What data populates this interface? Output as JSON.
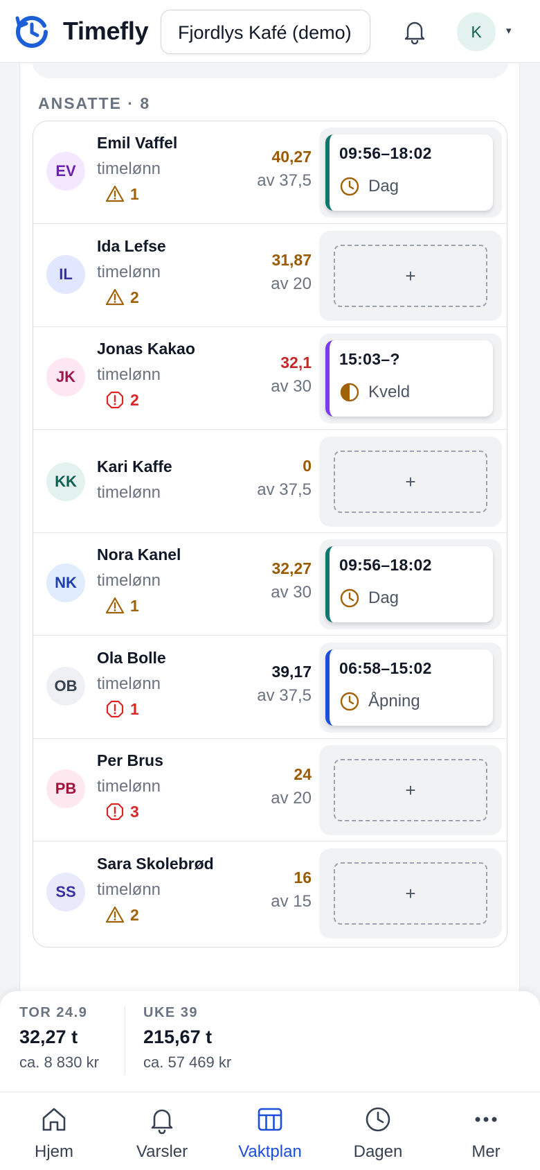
{
  "header": {
    "brand": "Timefly",
    "org_name": "Fjordlys Kafé (demo)",
    "user_initial": "K",
    "caret": "▾"
  },
  "section": {
    "title": "ANSATTE · 8"
  },
  "employees": [
    {
      "initials": "EV",
      "name": "Emil Vaffel",
      "pay_type": "timelønn",
      "warning_count": "1",
      "warning_kind": "warning",
      "hours": "40,27",
      "hours_status": "amber",
      "target": "av 37,5",
      "shift": {
        "time": "09:56–18:02",
        "type": "Dag",
        "type_icon": "clock-icon",
        "accent": "#0f766e"
      }
    },
    {
      "initials": "IL",
      "name": "Ida Lefse",
      "pay_type": "timelønn",
      "warning_count": "2",
      "warning_kind": "warning",
      "hours": "31,87",
      "hours_status": "amber",
      "target": "av 20",
      "add_label": "+"
    },
    {
      "initials": "JK",
      "name": "Jonas Kakao",
      "pay_type": "timelønn",
      "warning_count": "2",
      "warning_kind": "error",
      "hours": "32,1",
      "hours_status": "red",
      "target": "av 30",
      "shift": {
        "time": "15:03–?",
        "type": "Kveld",
        "type_icon": "half-circle-icon",
        "accent": "#7c3aed"
      }
    },
    {
      "initials": "KK",
      "name": "Kari Kaffe",
      "pay_type": "timelønn",
      "warning_count": "",
      "warning_kind": "none",
      "hours": "0",
      "hours_status": "amber",
      "target": "av 37,5",
      "add_label": "+"
    },
    {
      "initials": "NK",
      "name": "Nora Kanel",
      "pay_type": "timelønn",
      "warning_count": "1",
      "warning_kind": "warning",
      "hours": "32,27",
      "hours_status": "amber",
      "target": "av 30",
      "shift": {
        "time": "09:56–18:02",
        "type": "Dag",
        "type_icon": "clock-icon",
        "accent": "#0f766e"
      }
    },
    {
      "initials": "OB",
      "name": "Ola Bolle",
      "pay_type": "timelønn",
      "warning_count": "1",
      "warning_kind": "error",
      "hours": "39,17",
      "hours_status": "neutral",
      "target": "av 37,5",
      "shift": {
        "time": "06:58–15:02",
        "type": "Åpning",
        "type_icon": "clock-icon",
        "accent": "#1d4ed8"
      }
    },
    {
      "initials": "PB",
      "name": "Per Brus",
      "pay_type": "timelønn",
      "warning_count": "3",
      "warning_kind": "error",
      "hours": "24",
      "hours_status": "amber",
      "target": "av 20",
      "add_label": "+"
    },
    {
      "initials": "SS",
      "name": "Sara Skolebrød",
      "pay_type": "timelønn",
      "warning_count": "2",
      "warning_kind": "warning",
      "hours": "16",
      "hours_status": "amber",
      "target": "av 15",
      "add_label": "+"
    }
  ],
  "colors": {
    "amber": "#9a5a00",
    "red": "#c62828",
    "neutral": "#111827",
    "warning_icon": "#a16207",
    "error_icon": "#dc2626"
  },
  "avatar_colors": {
    "EV": [
      "#f3e8ff",
      "#6b21a8"
    ],
    "IL": [
      "#e0e7ff",
      "#3730a3"
    ],
    "JK": [
      "#fce7f3",
      "#9d174d"
    ],
    "KK": [
      "#e3f2ee",
      "#0f5f52"
    ],
    "NK": [
      "#e0ecfb",
      "#1e40af"
    ],
    "OB": [
      "#eef0f3",
      "#374151"
    ],
    "PB": [
      "#fde8ef",
      "#9f1239"
    ],
    "SS": [
      "#e8eafc",
      "#3730a3"
    ]
  },
  "summary": {
    "day": {
      "label": "TOR 24.9",
      "hours": "32,27 t",
      "money": "ca. 8 830 kr"
    },
    "week": {
      "label": "UKE 39",
      "hours": "215,67 t",
      "money": "ca. 57 469 kr"
    }
  },
  "nav": [
    {
      "label": "Hjem",
      "icon": "home-icon",
      "active": false
    },
    {
      "label": "Varsler",
      "icon": "bell-icon",
      "active": false
    },
    {
      "label": "Vaktplan",
      "icon": "calendar-grid-icon",
      "active": true
    },
    {
      "label": "Dagen",
      "icon": "clock-icon",
      "active": false
    },
    {
      "label": "Mer",
      "icon": "more-dots-icon",
      "active": false
    }
  ]
}
